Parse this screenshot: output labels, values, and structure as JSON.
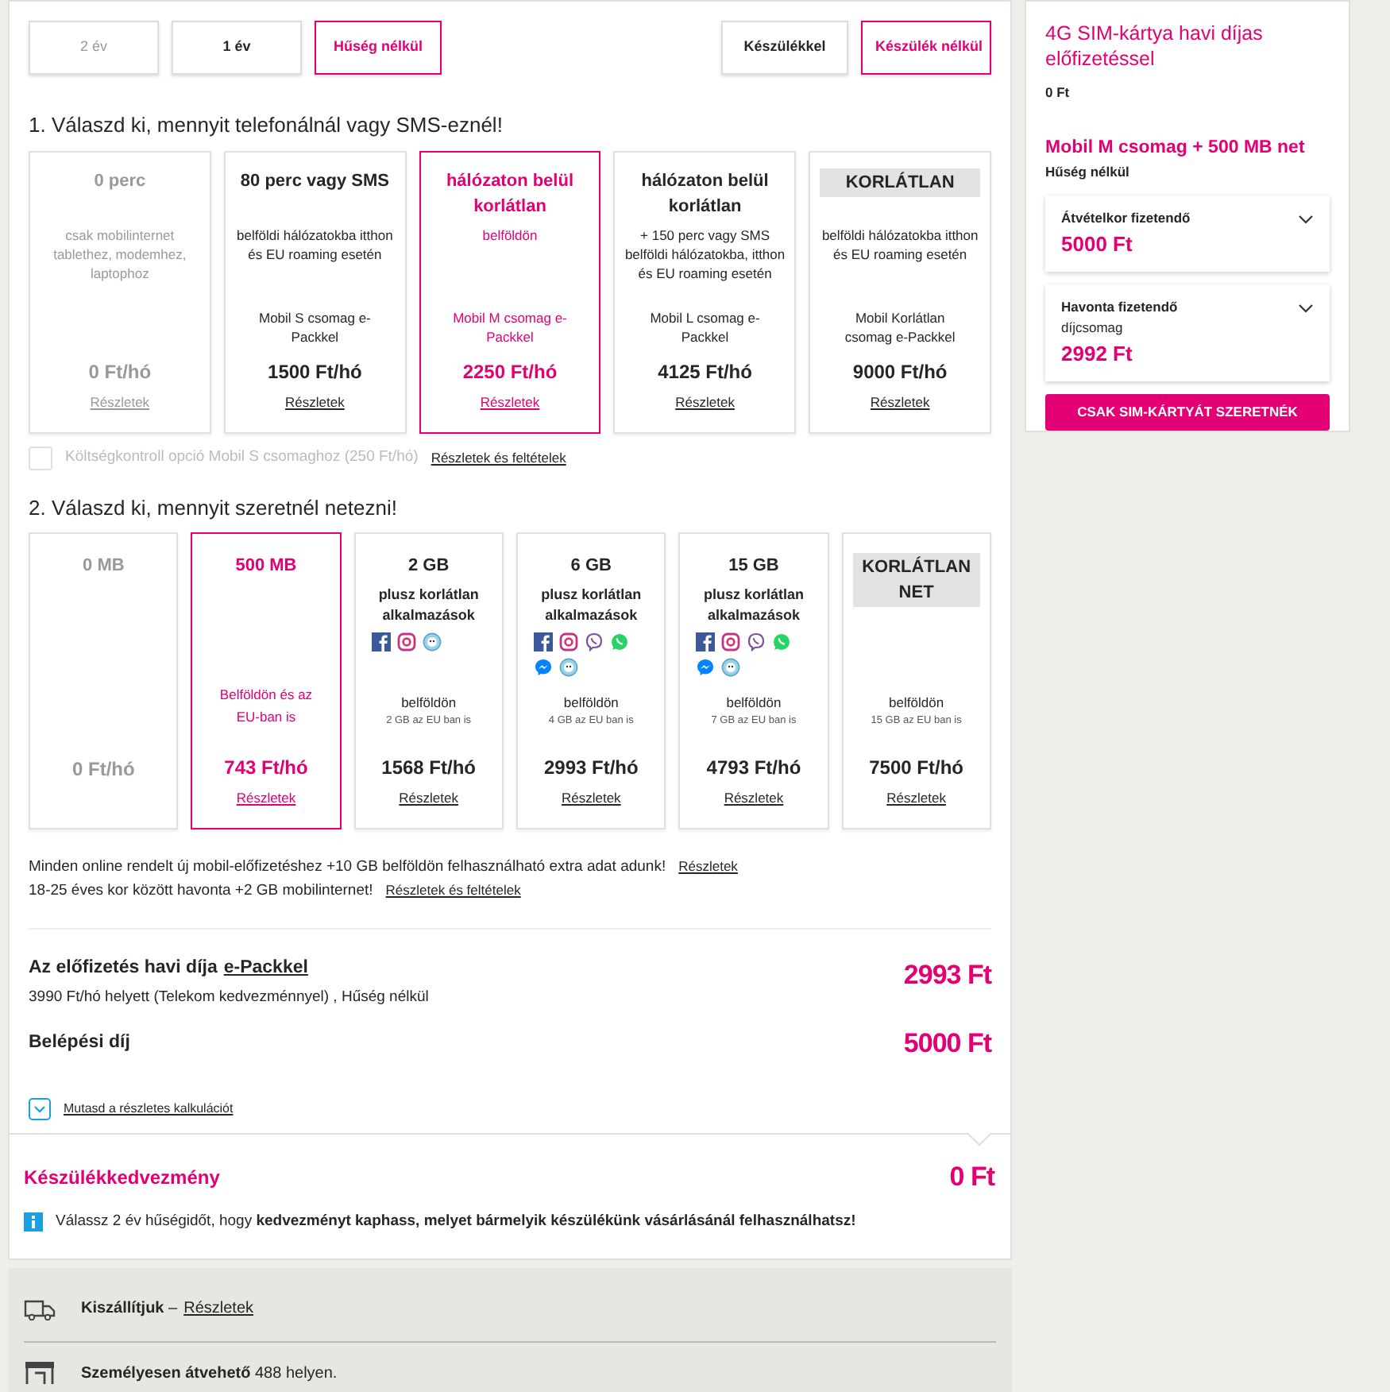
{
  "contract_tabs": [
    {
      "label": "2 év",
      "selected": false,
      "disabled": true
    },
    {
      "label": "1 év",
      "selected": false,
      "disabled": false
    },
    {
      "label": "Hűség nélkül",
      "selected": true,
      "disabled": false
    }
  ],
  "device_tabs": [
    {
      "label": "Készülékkel",
      "selected": false
    },
    {
      "label": "Készülék nélkül",
      "selected": true
    }
  ],
  "voice_section": {
    "heading": "1. Válaszd ki, mennyit telefonálnál vagy SMS-eznél!",
    "plans": [
      {
        "kind": "plain",
        "title": "0 perc",
        "description": "csak mobilinternet tablethez, modemhez, laptophoz",
        "price": "0 Ft/hó",
        "link": "Részletek",
        "selected": false,
        "disabled": true
      },
      {
        "kind": "plain",
        "title": "80 perc vagy SMS",
        "description": "belföldi hálózatokba itthon és EU roaming esetén",
        "package": "Mobil S csomag e-Packkel",
        "price": "1500 Ft/hó",
        "link": "Részletek",
        "selected": false,
        "disabled": false
      },
      {
        "kind": "plain",
        "title": "hálózaton belül korlátlan",
        "description": "belföldön",
        "package": "Mobil M csomag e-Packkel",
        "price": "2250 Ft/hó",
        "link": "Részletek",
        "selected": true,
        "disabled": false
      },
      {
        "kind": "plain",
        "title": "hálózaton belül korlátlan",
        "description": "+ 150 perc vagy SMS belföldi hálózatokba, itthon és EU roaming esetén",
        "package": "Mobil L csomag e-Packkel",
        "price": "4125 Ft/hó",
        "link": "Részletek",
        "selected": false,
        "disabled": false
      },
      {
        "kind": "boxed",
        "title": "KORLÁTLAN",
        "description": "belföldi hálózatokba itthon és EU roaming esetén",
        "package": "Mobil Korlátlan csomag e-Packkel",
        "price": "9000 Ft/hó",
        "link": "Részletek",
        "selected": false,
        "disabled": false
      }
    ],
    "option": {
      "label": "Költségkontroll opció Mobil S csomaghoz (250 Ft/hó)",
      "checked": false,
      "disabled": true,
      "link": "Részletek és feltételek"
    }
  },
  "data_section": {
    "heading": "2. Válaszd ki, mennyit szeretnél netezni!",
    "plans": [
      {
        "kind": "plain",
        "title": "0 MB",
        "price": "0 Ft/hó",
        "selected": false,
        "disabled": true
      },
      {
        "kind": "plain",
        "title": "500 MB",
        "region": "Belföldön és az EU-ban is",
        "price": "743 Ft/hó",
        "link": "Részletek",
        "selected": true,
        "disabled": false
      },
      {
        "kind": "plain",
        "title": "2 GB",
        "subtitle": "plusz korlátlan alkalmazások",
        "apps": [
          {
            "kind": "facebook"
          },
          {
            "kind": "instagram"
          },
          {
            "kind": "waze"
          }
        ],
        "region": "belföldön",
        "eu_note": "2 GB az EU ban is",
        "price": "1568 Ft/hó",
        "link": "Részletek",
        "selected": false,
        "disabled": false
      },
      {
        "kind": "plain",
        "title": "6 GB",
        "subtitle": "plusz korlátlan alkalmazások",
        "apps": [
          {
            "kind": "facebook"
          },
          {
            "kind": "instagram"
          },
          {
            "kind": "viber"
          },
          {
            "kind": "whatsapp"
          },
          {
            "kind": "messenger"
          },
          {
            "kind": "waze"
          }
        ],
        "region": "belföldön",
        "eu_note": "4 GB az EU ban is",
        "price": "2993 Ft/hó",
        "link": "Részletek",
        "selected": false,
        "disabled": false
      },
      {
        "kind": "plain",
        "title": "15 GB",
        "subtitle": "plusz korlátlan alkalmazások",
        "apps": [
          {
            "kind": "facebook"
          },
          {
            "kind": "instagram"
          },
          {
            "kind": "viber"
          },
          {
            "kind": "whatsapp"
          },
          {
            "kind": "messenger"
          },
          {
            "kind": "waze"
          }
        ],
        "region": "belföldön",
        "eu_note": "7 GB az EU ban is",
        "price": "4793 Ft/hó",
        "link": "Részletek",
        "selected": false,
        "disabled": false
      },
      {
        "kind": "boxed",
        "title": "KORLÁTLAN NET",
        "region": "belföldön",
        "eu_note": "15 GB az EU ban is",
        "price": "7500 Ft/hó",
        "link": "Részletek",
        "selected": false,
        "disabled": false
      }
    ]
  },
  "promos": [
    {
      "text": "Minden online rendelt új mobil-előfizetéshez +10 GB belföldön felhasználható extra adat adunk!",
      "link": "Részletek"
    },
    {
      "text": "18-25 éves kor között havonta +2 GB mobilinternet!",
      "link": "Részletek és feltételek"
    }
  ],
  "summary": {
    "monthly_label": "Az előfizetés havi díja",
    "monthly_link": "e-Packkel",
    "monthly_price": "2993 Ft",
    "monthly_note": "3990 Ft/hó helyett  (Telekom kedvezménnyel) , Hűség nélkül",
    "entry_label": "Belépési díj",
    "entry_price": "5000 Ft",
    "calc_link": "Mutasd a részletes kalkulációt"
  },
  "discount": {
    "title": "Készülékkedvezmény",
    "amount": "0 Ft",
    "info": "Válassz 2 év hűségidőt, hogy **kedvezményt kaphass, melyet bármelyik készülékünk vásárlásánál felhasználhatsz!**"
  },
  "delivery": [
    {
      "kind": "truck",
      "text": "**Kiszállítjuk** –",
      "link": "Részletek"
    },
    {
      "kind": "store",
      "text": "**Személyesen átvehető** 488 helyen."
    }
  ],
  "sidebar": {
    "sim_title": "4G SIM-kártya havi díjas előfizetéssel",
    "sim_price": "0 Ft",
    "plan_title": "Mobil M csomag + 500 MB net",
    "plan_note": "Hűség nélkül",
    "payments": [
      {
        "label": "Átvételkor fizetendő",
        "amount": "5000 Ft",
        "expanded": false
      },
      {
        "label": "Havonta fizetendő",
        "sublabel": "díjcsomag",
        "amount": "2992 Ft",
        "expanded": false
      }
    ],
    "button": "CSAK SIM-KÁRTYÁT SZERETNÉK"
  }
}
